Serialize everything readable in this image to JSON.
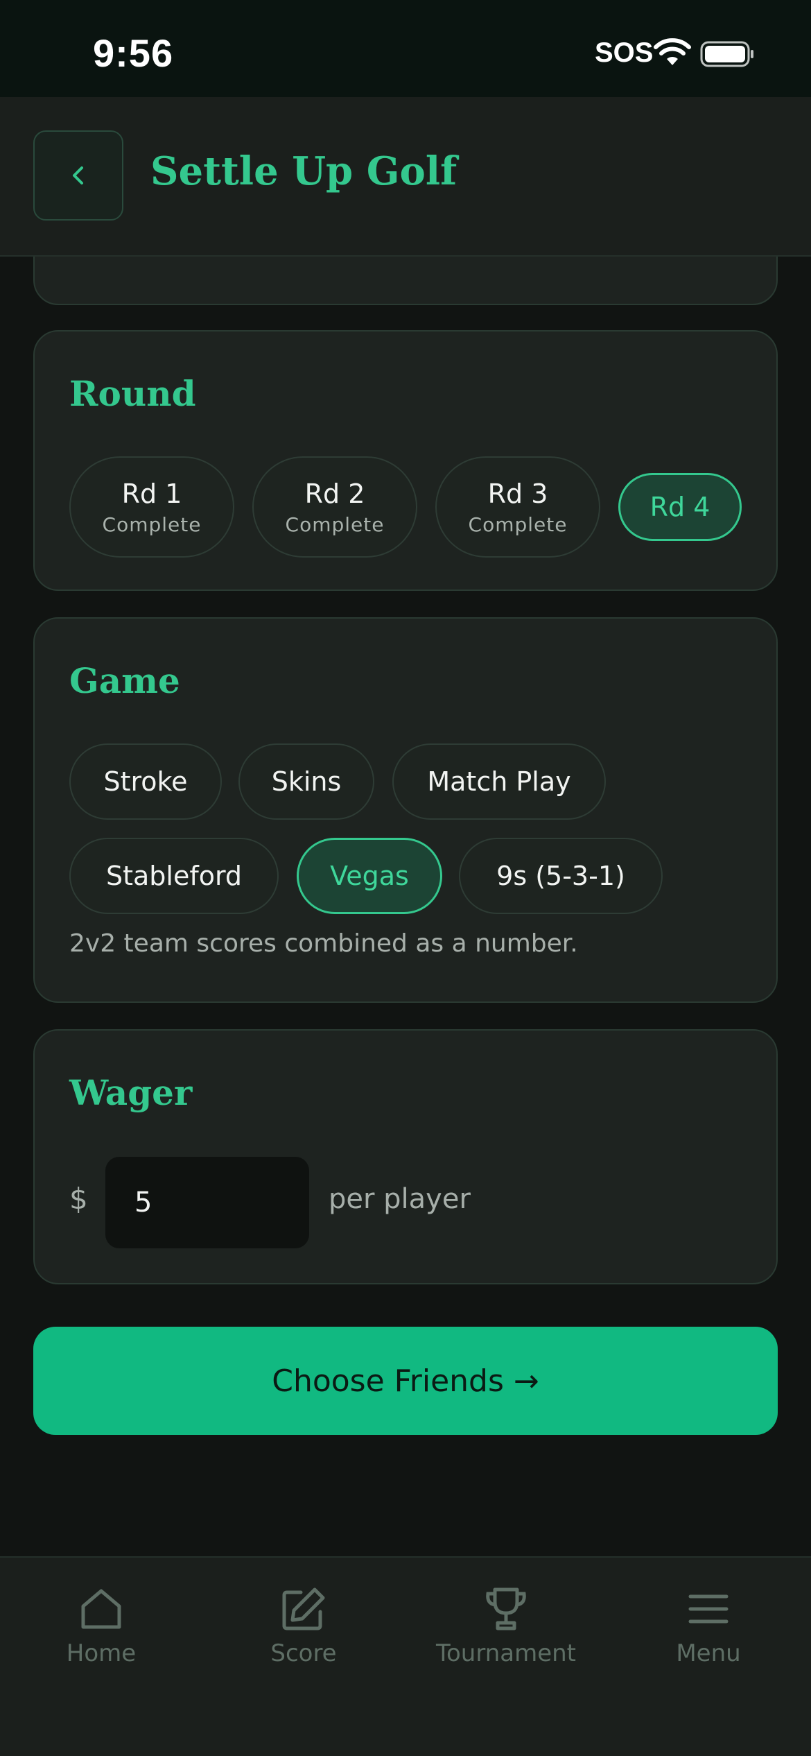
{
  "status_bar": {
    "time": "9:56",
    "carrier": "SOS"
  },
  "header": {
    "title": "Settle Up Golf"
  },
  "round": {
    "title": "Round",
    "options": [
      {
        "label": "Rd 1",
        "sub": "Complete"
      },
      {
        "label": "Rd 2",
        "sub": "Complete"
      },
      {
        "label": "Rd 3",
        "sub": "Complete"
      },
      {
        "label": "Rd 4",
        "sub": ""
      }
    ],
    "selected": "Rd 4"
  },
  "game": {
    "title": "Game",
    "options": [
      "Stroke",
      "Skins",
      "Match Play",
      "Stableford",
      "Vegas",
      "9s (5-3-1)"
    ],
    "selected": "Vegas",
    "description": "2v2 team scores combined as a number."
  },
  "wager": {
    "title": "Wager",
    "currency": "$",
    "value": "5",
    "suffix": "per player"
  },
  "cta": {
    "label": "Choose Friends →"
  },
  "tabs": [
    {
      "label": "Home",
      "icon": "home-icon"
    },
    {
      "label": "Score",
      "icon": "edit-icon"
    },
    {
      "label": "Tournament",
      "icon": "trophy-icon"
    },
    {
      "label": "Menu",
      "icon": "menu-icon"
    }
  ],
  "colors": {
    "accent": "#34C88E",
    "cta": "#11B981",
    "background": "#111412",
    "card": "#1E2320"
  }
}
